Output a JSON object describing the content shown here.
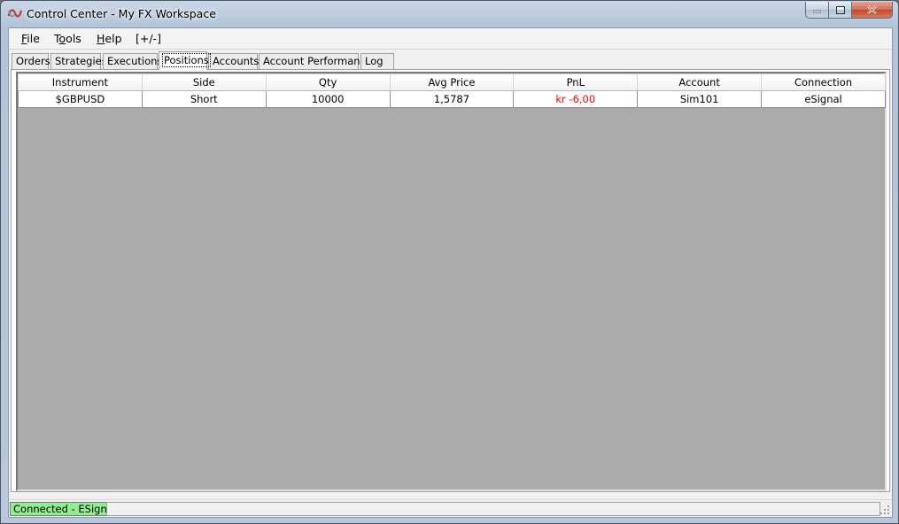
{
  "window": {
    "title": "Control Center - My FX Workspace"
  },
  "menu": [
    {
      "key": "F",
      "rest": "ile"
    },
    {
      "pre": "T",
      "key": "o",
      "rest": "ols"
    },
    {
      "key": "H",
      "rest": "elp"
    },
    {
      "label": "[+/-]"
    }
  ],
  "tabs": [
    "Orders",
    "Strategies",
    "Executions",
    "Positions",
    "Accounts",
    "Account Performance",
    "Log"
  ],
  "active_tab": "Positions",
  "table": {
    "columns": [
      "Instrument",
      "Side",
      "Qty",
      "Avg Price",
      "PnL",
      "Account",
      "Connection"
    ],
    "rows": [
      [
        "$GBPUSD",
        "Short",
        "10000",
        "1,5787",
        "kr -6,00",
        "Sim101",
        "eSignal"
      ]
    ]
  },
  "status": {
    "connection": "Connected - ESignal"
  },
  "colors": {
    "pnl_negative": "#ff0000",
    "connected": "#90ee90",
    "grid_background": "#ababab"
  }
}
